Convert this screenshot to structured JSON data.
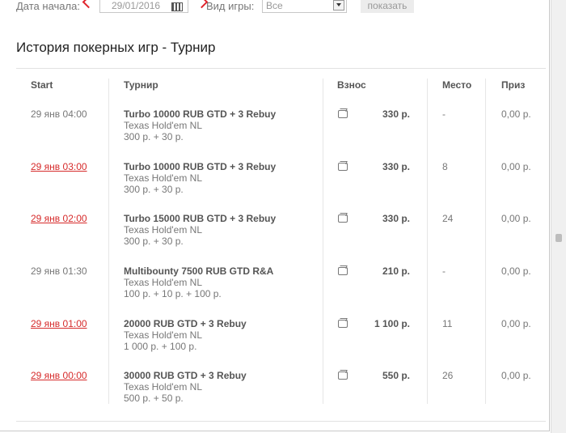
{
  "filters": {
    "start_date_label": "Дата начала:",
    "start_date_value": "29/01/2016",
    "game_type_label": "Вид игры:",
    "game_type_value": "Все",
    "show_button": "показать"
  },
  "title": "История покерных игр - Турнир",
  "columns": {
    "start": "Start",
    "tournament": "Турнир",
    "fee": "Взнос",
    "place": "Место",
    "prize": "Приз"
  },
  "rows": [
    {
      "start": "29 янв 04:00",
      "link": false,
      "name": "Turbo 10000 RUB GTD + 3 Rebuy",
      "game": "Texas Hold'em NL",
      "buyin": "300 р. + 30 р.",
      "fee": "330 р.",
      "place": "-",
      "prize": "0,00 р."
    },
    {
      "start": "29 янв 03:00",
      "link": true,
      "name": "Turbo 10000 RUB GTD + 3 Rebuy",
      "game": "Texas Hold'em NL",
      "buyin": "300 р. + 30 р.",
      "fee": "330 р.",
      "place": "8",
      "prize": "0,00 р."
    },
    {
      "start": "29 янв 02:00",
      "link": true,
      "name": "Turbo 15000 RUB GTD + 3 Rebuy",
      "game": "Texas Hold'em NL",
      "buyin": "300 р. + 30 р.",
      "fee": "330 р.",
      "place": "24",
      "prize": "0,00 р."
    },
    {
      "start": "29 янв 01:30",
      "link": false,
      "name": "Multibounty 7500 RUB GTD R&A",
      "game": "Texas Hold'em NL",
      "buyin": "100 р. + 10 р. + 100 р.",
      "fee": "210 р.",
      "place": "-",
      "prize": "0,00 р."
    },
    {
      "start": "29 янв 01:00",
      "link": true,
      "name": "20000 RUB GTD + 3 Rebuy",
      "game": "Texas Hold'em NL",
      "buyin": "1 000 р. + 100 р.",
      "fee": "1 100 р.",
      "place": "11",
      "prize": "0,00 р."
    },
    {
      "start": "29 янв 00:00",
      "link": true,
      "name": "30000 RUB GTD + 3 Rebuy",
      "game": "Texas Hold'em NL",
      "buyin": "500 р. + 50 р.",
      "fee": "550 р.",
      "place": "26",
      "prize": "0,00 р."
    }
  ]
}
